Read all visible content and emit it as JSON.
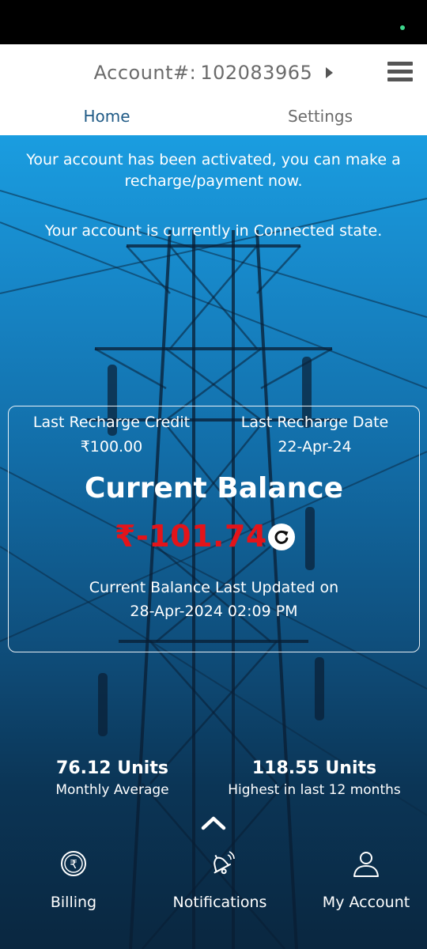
{
  "header": {
    "account_label": "Account#:",
    "account_number": "102083965",
    "menu_icon": "hamburger-menu-icon",
    "tabs": [
      {
        "label": "Home",
        "active": true
      },
      {
        "label": "Settings",
        "active": false
      }
    ]
  },
  "notices": {
    "activated": "Your account has been activated, you can make a recharge/payment now.",
    "state": "Your account is currently in Connected state."
  },
  "balance_card": {
    "last_recharge_credit_label": "Last Recharge Credit",
    "last_recharge_credit_value": "₹100.00",
    "last_recharge_date_label": "Last Recharge Date",
    "last_recharge_date_value": "22-Apr-24",
    "current_balance_label": "Current Balance",
    "current_balance_value": "₹-101.74",
    "updated_label": "Current Balance Last Updated on",
    "updated_value": "28-Apr-2024 02:09 PM",
    "refresh_icon": "refresh-icon"
  },
  "stats": {
    "monthly_average_value": "76.12 Units",
    "monthly_average_label": "Monthly Average",
    "highest_value": "118.55 Units",
    "highest_label": "Highest in last 12 months"
  },
  "bottom_nav": {
    "expand_icon": "chevron-up-icon",
    "items": [
      {
        "label": "Billing",
        "icon": "rupee-coin-icon"
      },
      {
        "label": "Notifications",
        "icon": "bell-icon"
      },
      {
        "label": "My Account",
        "icon": "user-icon"
      }
    ]
  },
  "colors": {
    "balance_negative": "#e3141a",
    "tab_active": "#1f5a86",
    "background_top": "#1a9de0",
    "background_bottom": "#0a2740"
  }
}
